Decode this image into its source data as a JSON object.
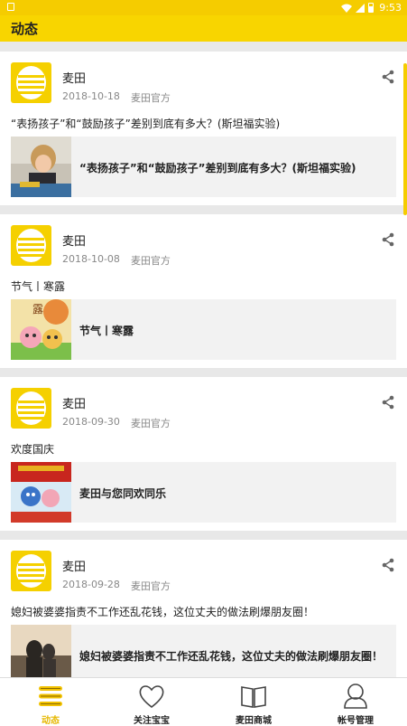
{
  "status_bar": {
    "time": "9:53"
  },
  "app_bar": {
    "title": "动态"
  },
  "posts": [
    {
      "author": "麦田",
      "date": "2018-10-18",
      "source": "麦田官方",
      "caption": "“表扬孩子”和“鼓励孩子”差别到底有多大？(斯坦福实验)",
      "link_title": "“表扬孩子”和“鼓励孩子”差别到底有多大？(斯坦福实验)",
      "thumb_text": ""
    },
    {
      "author": "麦田",
      "date": "2018-10-08",
      "source": "麦田官方",
      "caption": "节气丨寒露",
      "link_title": "节气丨寒露",
      "thumb_text": "露"
    },
    {
      "author": "麦田",
      "date": "2018-09-30",
      "source": "麦田官方",
      "caption": "欢度国庆",
      "link_title": "麦田与您同欢同乐",
      "thumb_text": ""
    },
    {
      "author": "麦田",
      "date": "2018-09-28",
      "source": "麦田官方",
      "caption": "媳妇被婆婆指责不工作还乱花钱，这位丈夫的做法刷爆朋友圈！",
      "link_title": "媳妇被婆婆指责不工作还乱花钱，这位丈夫的做法刷爆朋友圈！",
      "thumb_text": ""
    }
  ],
  "tabs": [
    {
      "label": "动态",
      "icon": "list-icon",
      "active": true
    },
    {
      "label": "关注宝宝",
      "icon": "heart-icon",
      "active": false
    },
    {
      "label": "麦田商城",
      "icon": "book-icon",
      "active": false
    },
    {
      "label": "帐号管理",
      "icon": "user-icon",
      "active": false
    }
  ],
  "colors": {
    "accent": "#f8d500",
    "tab_active": "#e6b800"
  }
}
